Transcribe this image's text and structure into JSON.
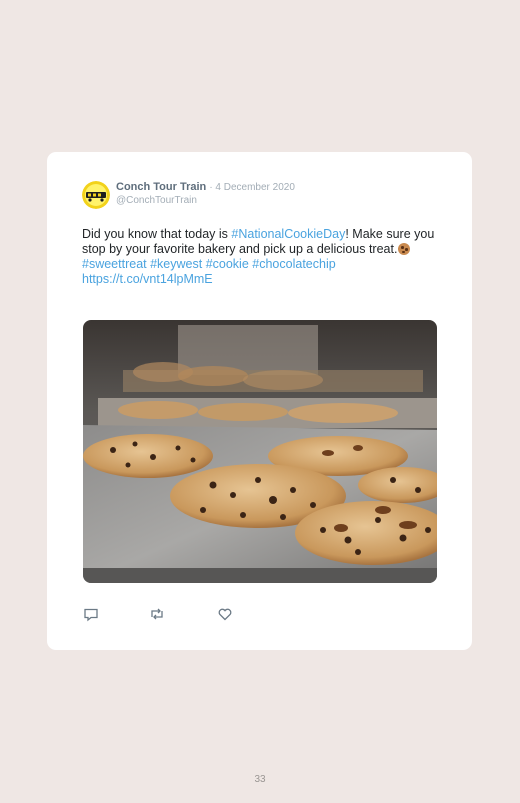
{
  "tweet": {
    "display_name": "Conch Tour Train",
    "date": "· 4 December 2020",
    "handle": "@ConchTourTrain",
    "text_1": "Did you know that today is ",
    "hashtag_main": "#NationalCookieDay",
    "text_2": "! Make sure you stop by your favorite bakery and pick up a delicious treat.",
    "hashtags": [
      "#sweettreat",
      "#keywest",
      "#cookie",
      "#chocolatechip"
    ],
    "url": "https://t.co/vnt14lpMmE"
  },
  "actions": [
    {
      "name": "reply",
      "icon": "comment-icon"
    },
    {
      "name": "retweet",
      "icon": "retweet-icon"
    },
    {
      "name": "like",
      "icon": "heart-icon"
    }
  ],
  "page": {
    "number": "33"
  },
  "colors": {
    "link": "#4aa3df",
    "icon": "#6b7985",
    "background": "#efe7e4"
  }
}
